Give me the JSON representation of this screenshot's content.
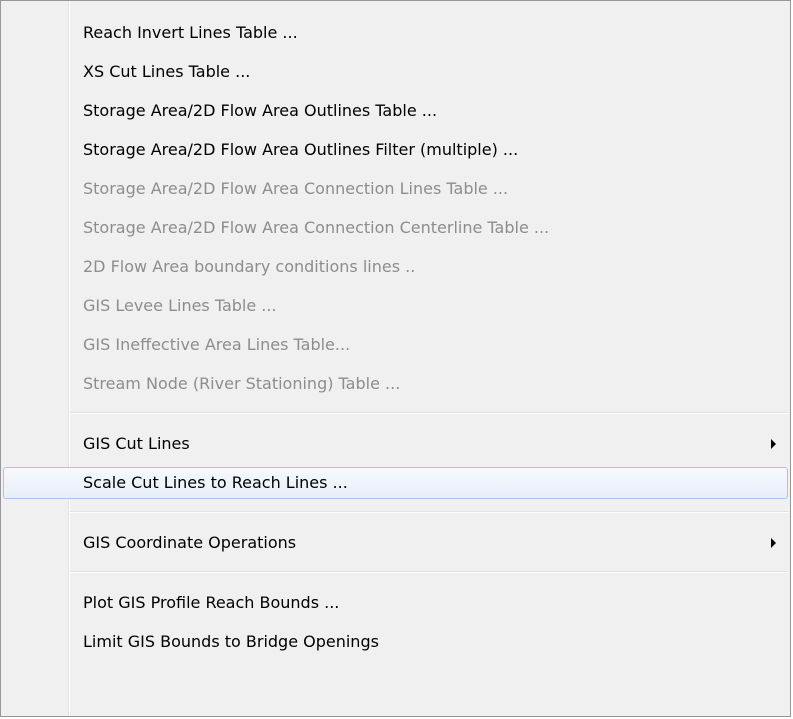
{
  "menu": {
    "items": [
      {
        "label": "Reach Invert Lines Table ..."
      },
      {
        "label": "XS Cut Lines Table ..."
      },
      {
        "label": "Storage Area/2D Flow Area Outlines Table ..."
      },
      {
        "label": "Storage Area/2D Flow Area Outlines Filter (multiple) ..."
      },
      {
        "label": "Storage Area/2D Flow Area Connection Lines Table ..."
      },
      {
        "label": "Storage Area/2D Flow Area Connection Centerline Table ..."
      },
      {
        "label": "2D Flow Area boundary conditions lines .."
      },
      {
        "label": "GIS Levee Lines Table ..."
      },
      {
        "label": "GIS Ineffective Area Lines Table..."
      },
      {
        "label": "Stream Node (River Stationing) Table ..."
      },
      {
        "label": "GIS Cut Lines"
      },
      {
        "label": "Scale Cut Lines to Reach Lines ..."
      },
      {
        "label": "GIS Coordinate Operations"
      },
      {
        "label": "Plot GIS Profile Reach Bounds ..."
      },
      {
        "label": "Limit GIS Bounds to Bridge Openings"
      }
    ],
    "submenu_arrow_icon": "triangle-right-icon",
    "colors": {
      "background": "#f0f0f0",
      "enabled_text": "#000000",
      "disabled_text": "#8d8d8d",
      "hover_border": "#a9c5e8",
      "hover_fill": "#e6eff9"
    }
  }
}
